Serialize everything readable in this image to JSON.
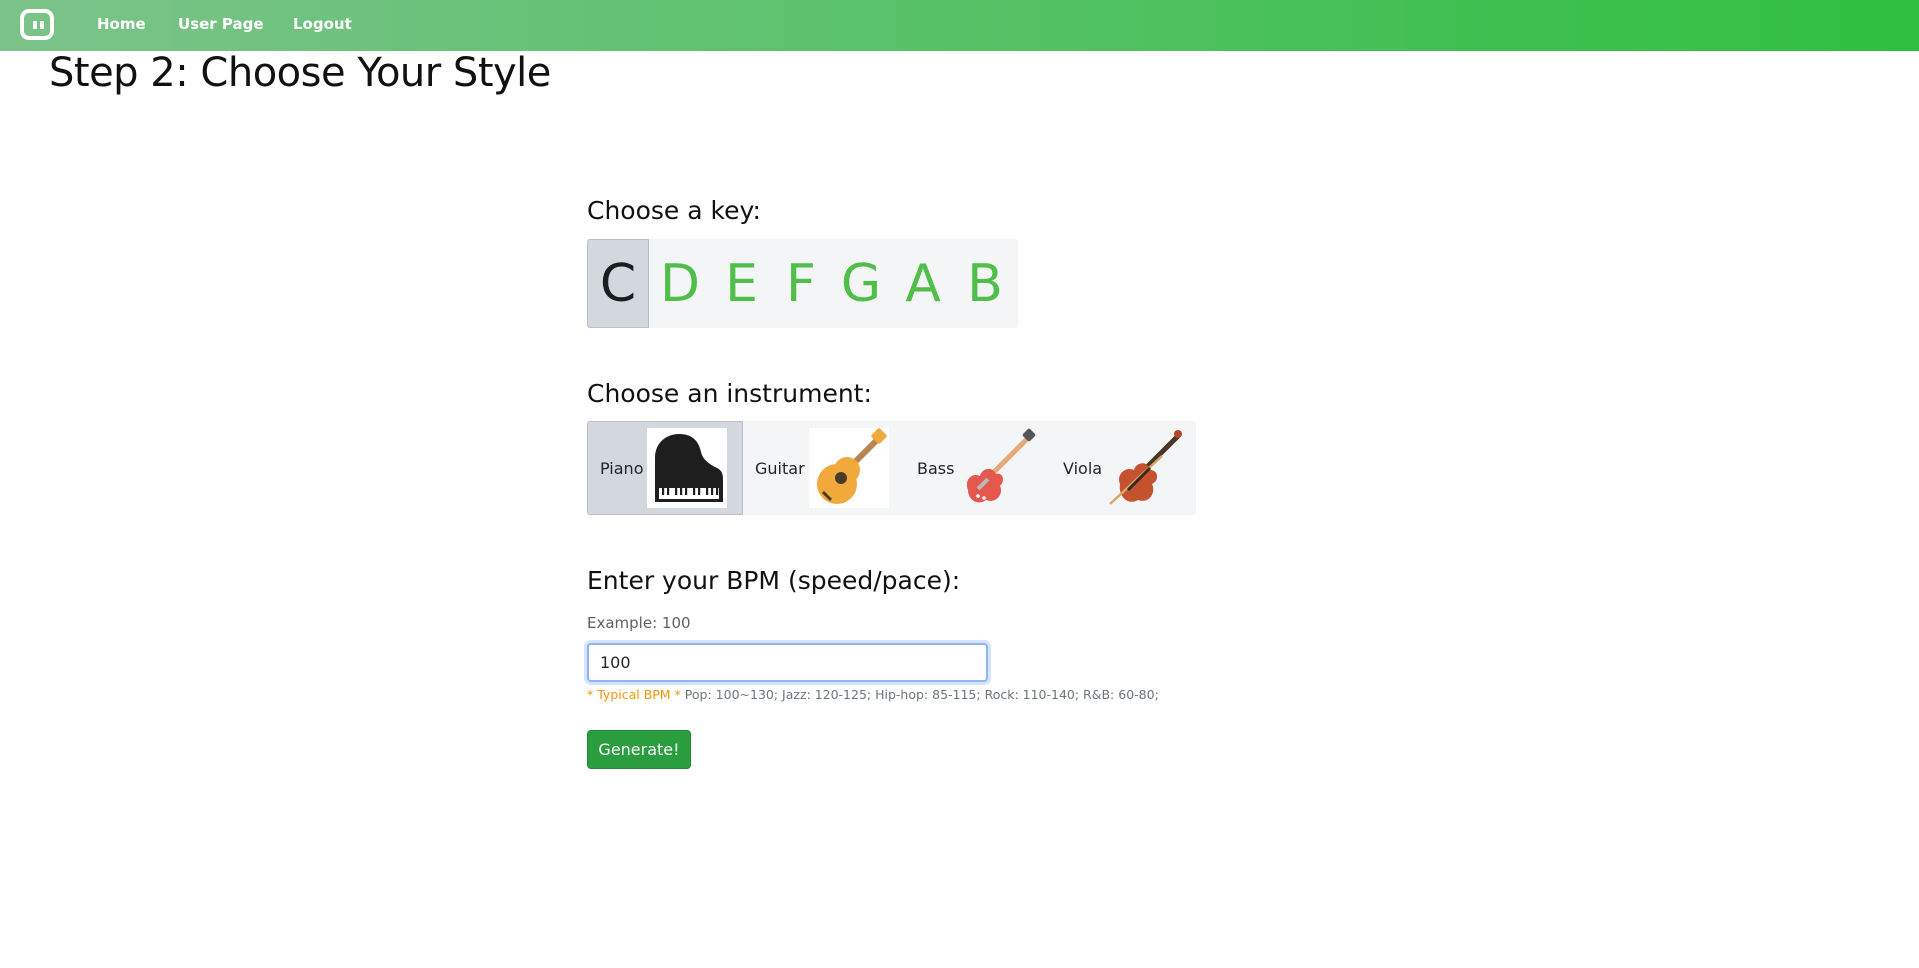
{
  "nav": {
    "logo": "app-logo-icon",
    "items": [
      {
        "label": "Home"
      },
      {
        "label": "User Page"
      },
      {
        "label": "Logout"
      }
    ]
  },
  "page": {
    "title": "Step 2: Choose Your Style"
  },
  "key_section": {
    "label": "Choose a key:",
    "keys": [
      "C",
      "D",
      "E",
      "F",
      "G",
      "A",
      "B"
    ],
    "selected": "C"
  },
  "instrument_section": {
    "label": "Choose an instrument:",
    "instruments": [
      {
        "label": "Piano",
        "icon": "grand-piano-icon"
      },
      {
        "label": "Guitar",
        "icon": "acoustic-guitar-icon"
      },
      {
        "label": "Bass",
        "icon": "bass-guitar-icon"
      },
      {
        "label": "Viola",
        "icon": "viola-icon"
      }
    ],
    "selected": "Piano"
  },
  "bpm_section": {
    "label": "Enter your BPM (speed/pace):",
    "helper": "Example: 100",
    "value": "100",
    "hint_prefix": "* Typical BPM *",
    "hint_text": " Pop: 100~130; Jazz: 120-125; Hip-hop: 85-115; Rock: 110-140; R&B: 60-80;"
  },
  "generate_button": {
    "label": "Generate!"
  },
  "colors": {
    "navbar_start": "#7cc38a",
    "navbar_end": "#2ebf3f",
    "key_text": "#4fbf4a",
    "selected_bg": "#d3d8df",
    "button": "#2a9d3f",
    "hint_accent": "#f0960e"
  }
}
